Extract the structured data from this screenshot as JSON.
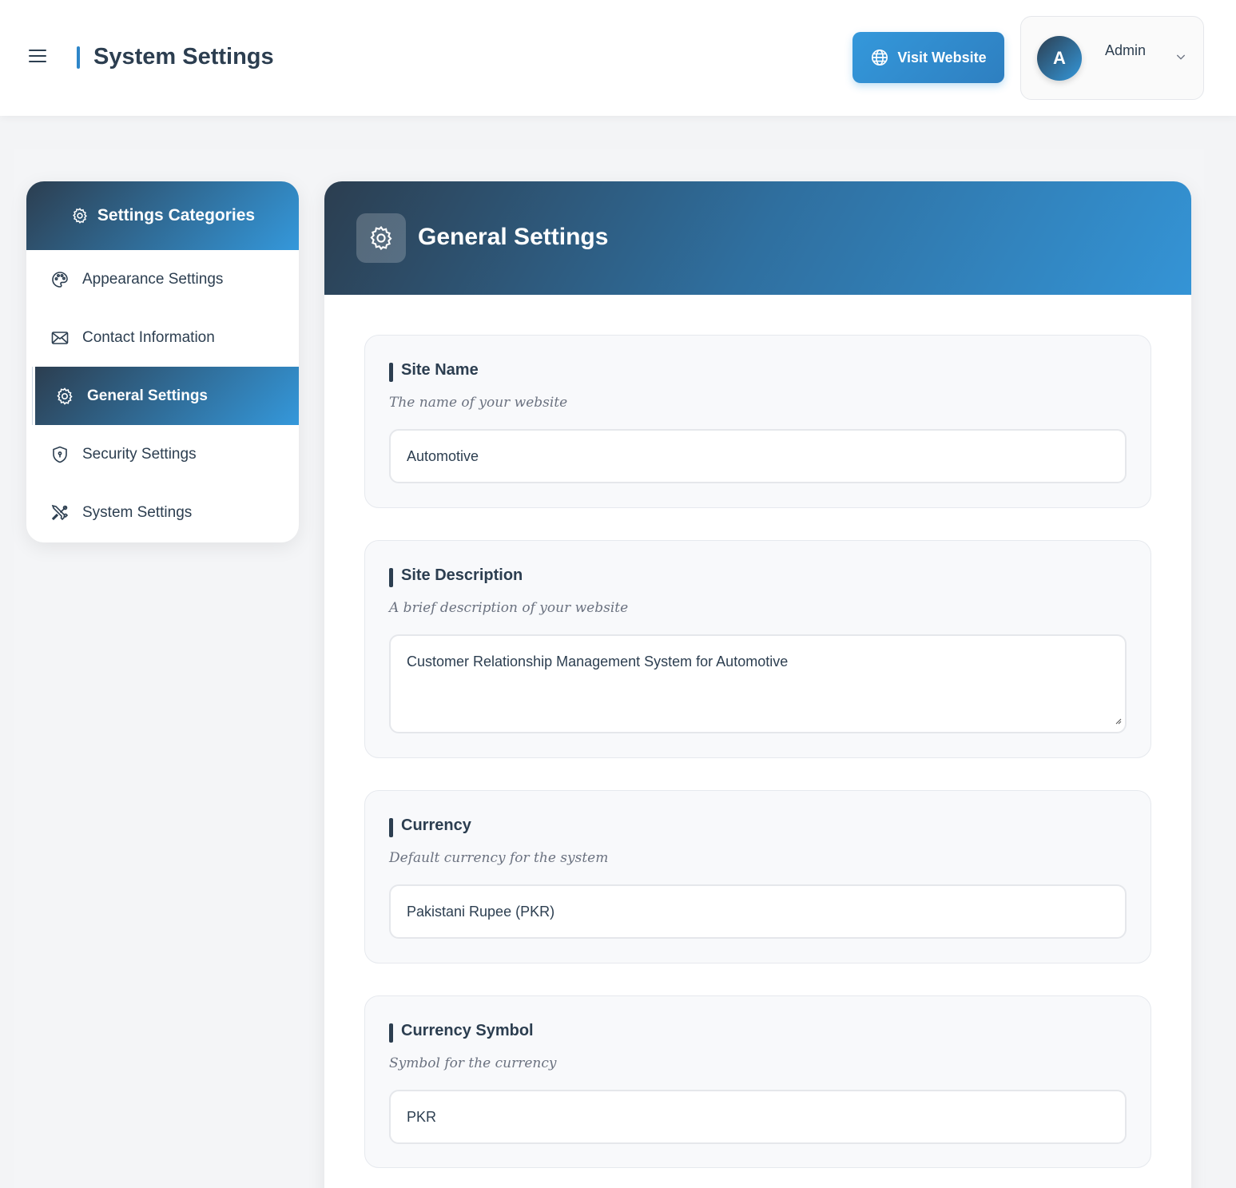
{
  "header": {
    "title": "System Settings",
    "visit_button": "Visit Website",
    "user": {
      "initial": "A",
      "name": "Admin"
    }
  },
  "sidebar": {
    "heading": "Settings Categories",
    "items": [
      {
        "label": "Appearance Settings",
        "icon": "palette-icon"
      },
      {
        "label": "Contact Information",
        "icon": "envelope-icon"
      },
      {
        "label": "General Settings",
        "icon": "gear-icon",
        "active": true
      },
      {
        "label": "Security Settings",
        "icon": "shield-icon"
      },
      {
        "label": "System Settings",
        "icon": "tools-icon"
      }
    ]
  },
  "main": {
    "title": "General Settings",
    "fields": [
      {
        "label": "Site Name",
        "hint": "The name of your website",
        "value": "Automotive"
      },
      {
        "label": "Site Description",
        "hint": "A brief description of your website",
        "value": "Customer Relationship Management System for Automotive"
      },
      {
        "label": "Currency",
        "hint": "Default currency for the system",
        "value": "Pakistani Rupee (PKR)"
      },
      {
        "label": "Currency Symbol",
        "hint": "Symbol for the currency",
        "value": "PKR"
      }
    ]
  },
  "colors": {
    "primary_dark": "#2c3e50",
    "accent_blue": "#3498db"
  }
}
